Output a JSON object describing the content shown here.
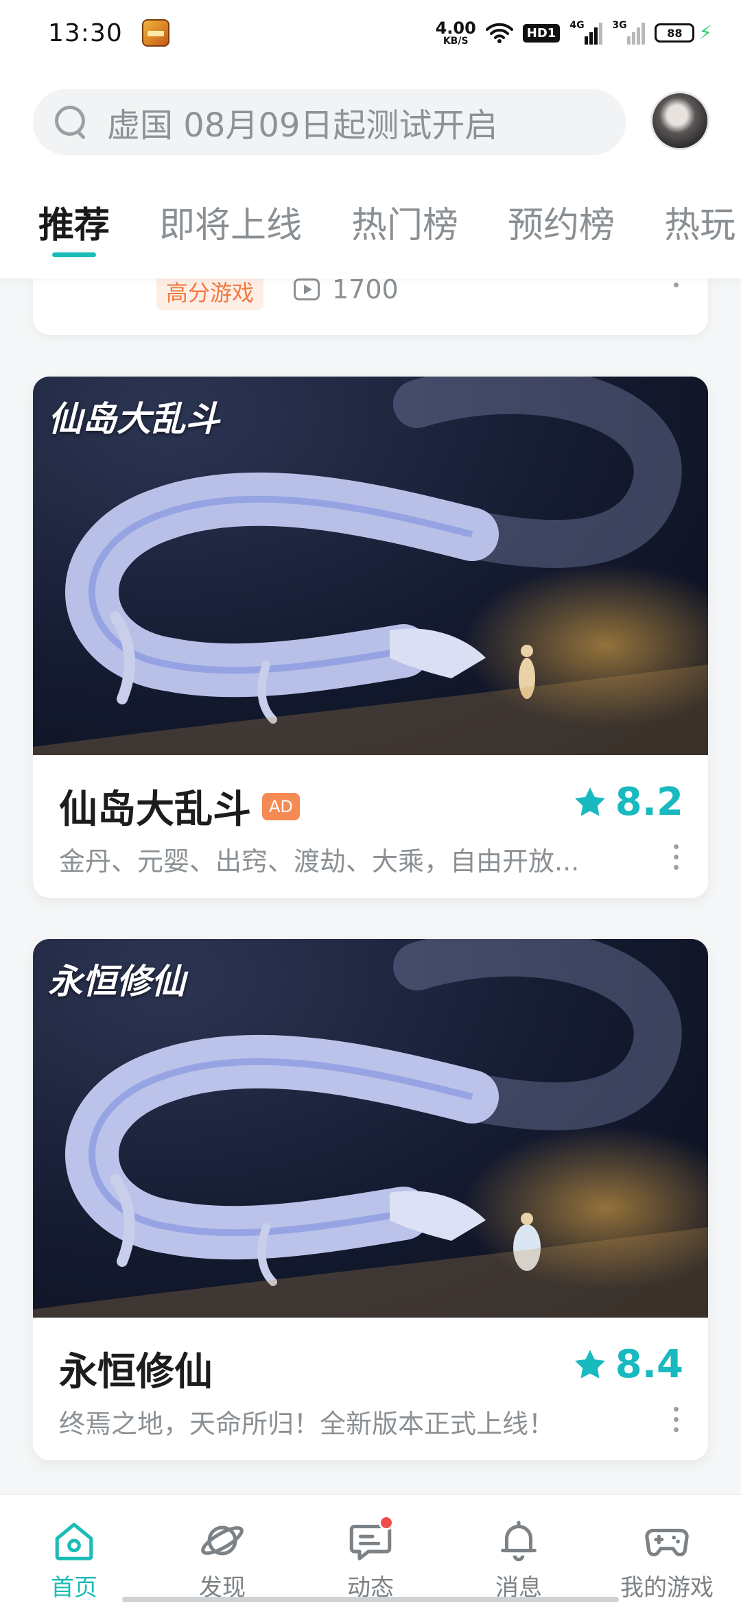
{
  "status_bar": {
    "time": "13:30",
    "net_speed_value": "4.00",
    "net_speed_unit": "KB/S",
    "hd_label": "HD1",
    "sim1_label": "4G",
    "sim2_label": "3G",
    "battery_percent": "88"
  },
  "search": {
    "placeholder": "虚国 08月09日起测试开启"
  },
  "tabs": [
    {
      "label": "推荐"
    },
    {
      "label": "即将上线"
    },
    {
      "label": "热门榜"
    },
    {
      "label": "预约榜"
    },
    {
      "label": "热玩"
    }
  ],
  "prev_card": {
    "tag": "高分游戏",
    "play_count": "1700"
  },
  "games": [
    {
      "title": "仙岛大乱斗",
      "ad_label": "AD",
      "rating": "8.2",
      "description": "金丹、元婴、出窍、渡劫、大乘，自由开放...",
      "banner_logo": "仙岛大乱斗"
    },
    {
      "title": "永恒修仙",
      "rating": "8.4",
      "description": "终焉之地，天命所归！全新版本正式上线！",
      "banner_logo": "永恒修仙"
    }
  ],
  "bottom_nav": [
    {
      "label": "首页",
      "icon": "home-icon"
    },
    {
      "label": "发现",
      "icon": "planet-icon"
    },
    {
      "label": "动态",
      "icon": "chat-icon"
    },
    {
      "label": "消息",
      "icon": "bell-icon"
    },
    {
      "label": "我的游戏",
      "icon": "gamepad-icon"
    }
  ],
  "colors": {
    "accent": "#1bbcb6",
    "rating": "#19b9c0",
    "ad_badge": "#f58a52",
    "tag_text": "#f27a3f"
  }
}
